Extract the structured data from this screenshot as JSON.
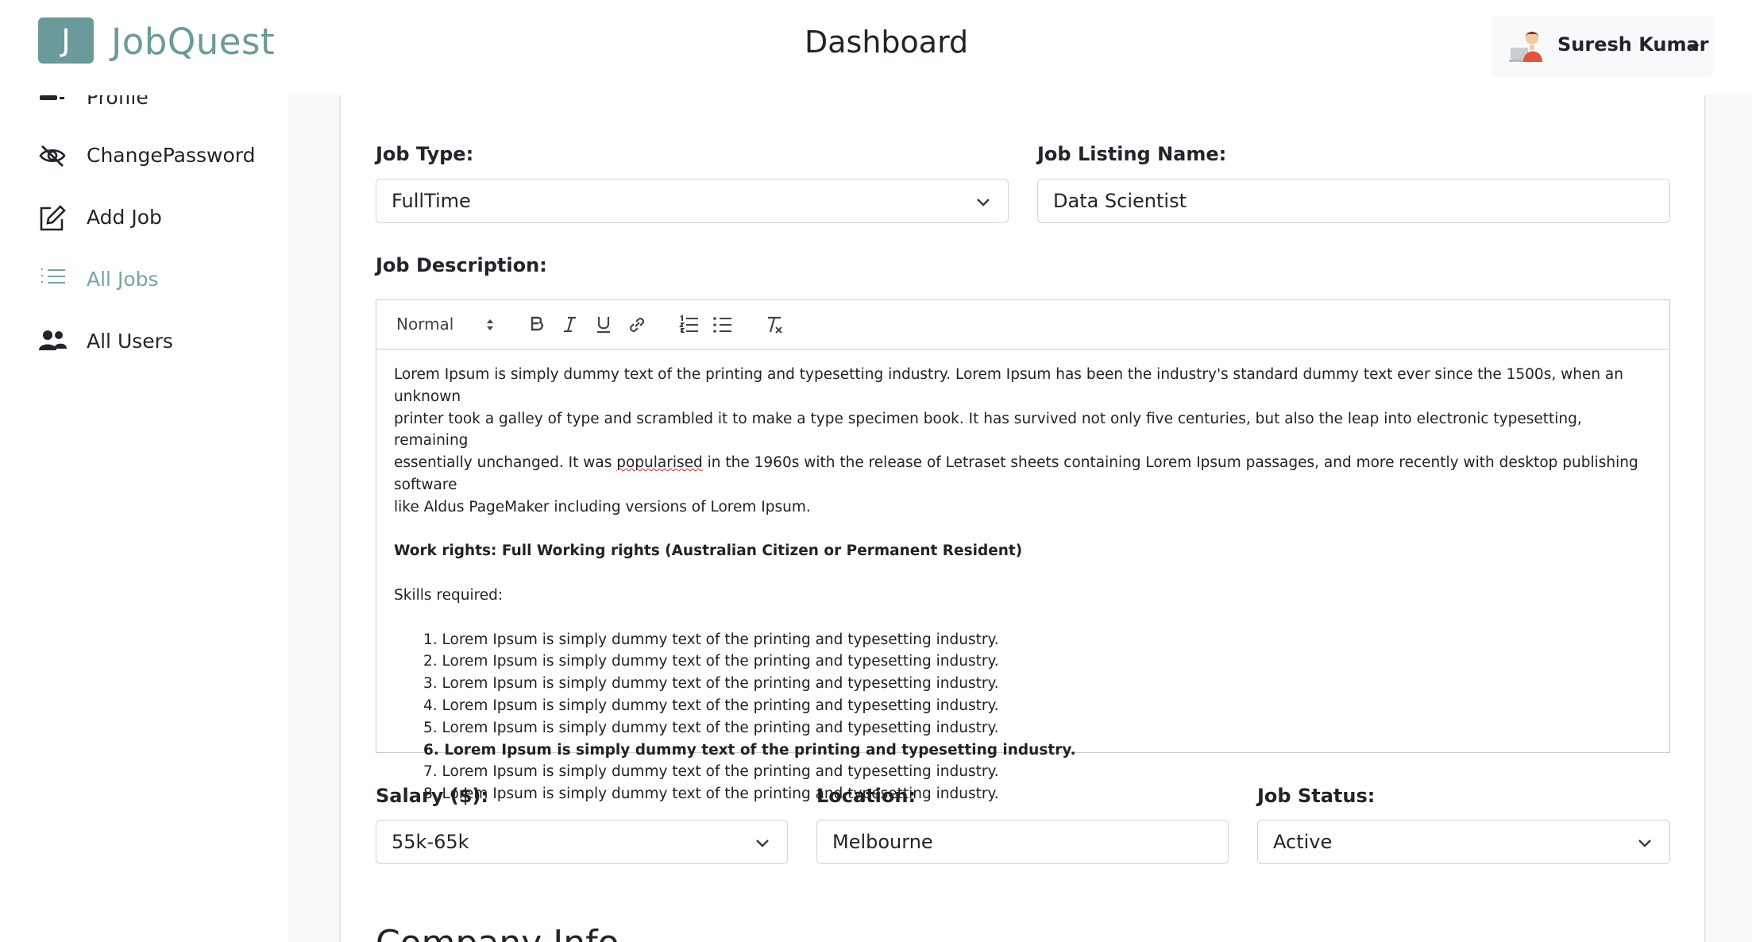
{
  "app": {
    "logo_letter": "J",
    "name": "JobQuest",
    "page_title": "Dashboard",
    "user_name": "Suresh Kumar"
  },
  "sidebar": {
    "items": [
      {
        "label": "Profile",
        "icon": "person-card-icon",
        "active": false
      },
      {
        "label": "ChangePassword",
        "icon": "eye-slash-icon",
        "active": false
      },
      {
        "label": "Add Job",
        "icon": "pencil-square-icon",
        "active": false
      },
      {
        "label": "All Jobs",
        "icon": "list-icon",
        "active": true
      },
      {
        "label": "All Users",
        "icon": "users-icon",
        "active": false
      }
    ]
  },
  "form": {
    "job_type": {
      "label": "Job Type:",
      "value": "FullTime"
    },
    "job_listing_name": {
      "label": "Job Listing Name:",
      "value": "Data Scientist"
    },
    "job_description": {
      "label": "Job Description:",
      "toolbar": {
        "format_value": "Normal"
      },
      "paragraph_lines": [
        "Lorem Ipsum is simply dummy text of the printing and typesetting industry. Lorem Ipsum has been the industry's standard dummy text ever since the 1500s, when an unknown",
        "printer took a galley of type and scrambled it to make a type specimen book. It has survived not only five centuries, but also the leap into electronic typesetting, remaining",
        "essentially unchanged. It was ",
        "popularised",
        " in the 1960s with the release of Letraset sheets containing Lorem Ipsum passages, and more recently with desktop publishing software",
        "like Aldus PageMaker including versions of Lorem Ipsum."
      ],
      "work_rights": "Work rights: Full Working rights (Australian Citizen or Permanent Resident)",
      "skills_heading": "Skills required:",
      "skills": [
        "1. Lorem Ipsum is simply dummy text of the printing and typesetting industry.",
        "2. Lorem Ipsum is simply dummy text of the printing and typesetting industry.",
        "3. Lorem Ipsum is simply dummy text of the printing and typesetting industry.",
        "4. Lorem Ipsum is simply dummy text of the printing and typesetting industry.",
        "5. Lorem Ipsum is simply dummy text of the printing and typesetting industry.",
        "6. Lorem Ipsum is simply dummy text of the printing and typesetting industry.",
        "7. Lorem Ipsum is simply dummy text of the printing and typesetting industry.",
        "8. Lorem Ipsum is simply dummy text of the printing and typesetting industry."
      ]
    },
    "salary": {
      "label": "Salary ($):",
      "value": "55k-65k"
    },
    "location": {
      "label": "Location:",
      "value": "Melbourne"
    },
    "job_status": {
      "label": "Job Status:",
      "value": "Active"
    },
    "company_info_heading": "Company Info"
  },
  "colors": {
    "brand": "#6b9a9a",
    "active_nav": "#7aa3a3",
    "spellcheck": "#e0212f"
  }
}
